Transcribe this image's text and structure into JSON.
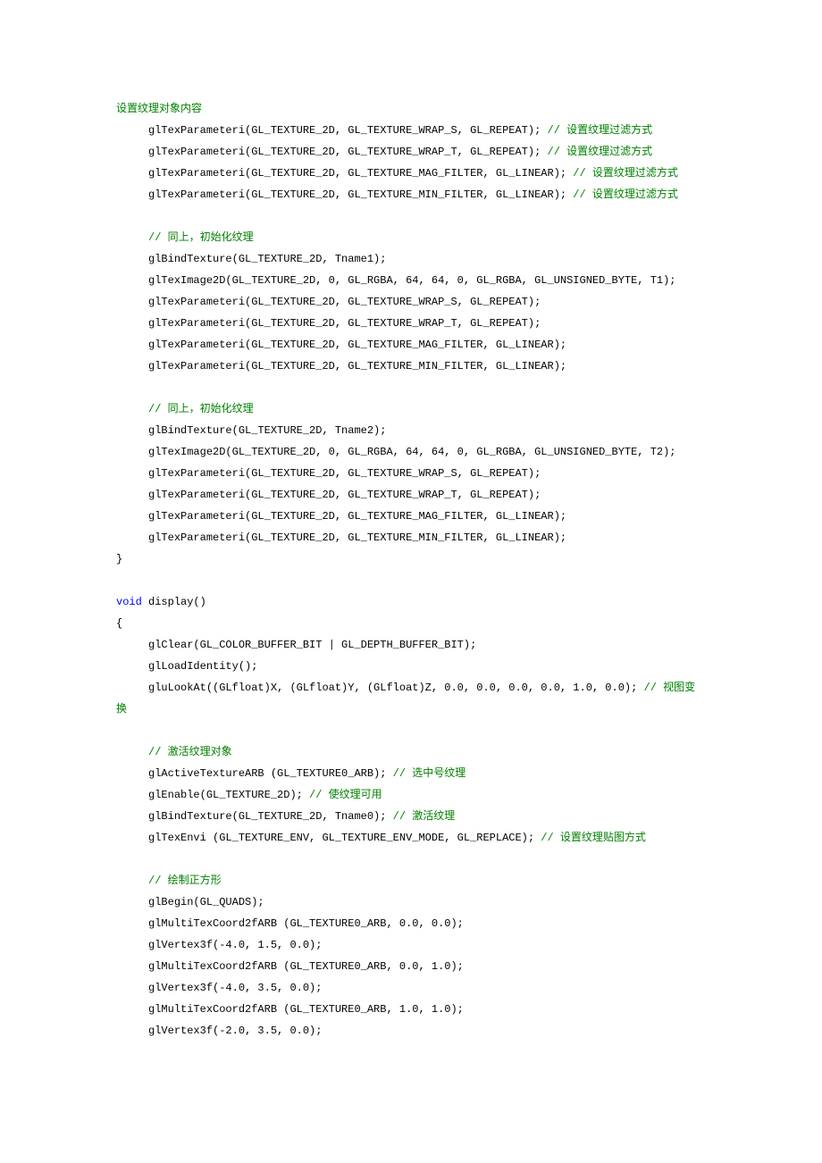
{
  "lines": [
    {
      "indent": 0,
      "segs": [
        {
          "t": "设置纹理对象内容",
          "c": "c-green"
        }
      ]
    },
    {
      "indent": 1,
      "segs": [
        {
          "t": "glTexParameteri(GL_TEXTURE_2D, GL_TEXTURE_WRAP_S, GL_REPEAT);"
        },
        {
          "t": " // 设置纹理过滤方式",
          "c": "c-green"
        }
      ]
    },
    {
      "indent": 1,
      "segs": [
        {
          "t": "glTexParameteri(GL_TEXTURE_2D, GL_TEXTURE_WRAP_T, GL_REPEAT);"
        },
        {
          "t": " // 设置纹理过滤方式",
          "c": "c-green"
        }
      ]
    },
    {
      "indent": 1,
      "segs": [
        {
          "t": "glTexParameteri(GL_TEXTURE_2D, GL_TEXTURE_MAG_FILTER, GL_LINEAR);"
        },
        {
          "t": " // 设置纹理过滤方式",
          "c": "c-green"
        }
      ]
    },
    {
      "indent": 1,
      "segs": [
        {
          "t": "glTexParameteri(GL_TEXTURE_2D, GL_TEXTURE_MIN_FILTER, GL_LINEAR);"
        },
        {
          "t": " // 设置纹理过滤方式",
          "c": "c-green"
        }
      ]
    },
    {
      "indent": 0,
      "segs": [
        {
          "t": " "
        }
      ]
    },
    {
      "indent": 1,
      "segs": [
        {
          "t": "// 同上，初始化纹理",
          "c": "c-green"
        }
      ]
    },
    {
      "indent": 1,
      "segs": [
        {
          "t": "glBindTexture(GL_TEXTURE_2D, Tname1);"
        }
      ]
    },
    {
      "indent": 1,
      "segs": [
        {
          "t": "glTexImage2D(GL_TEXTURE_2D, 0, GL_RGBA, 64, 64, 0, GL_RGBA, GL_UNSIGNED_BYTE, T1);"
        }
      ]
    },
    {
      "indent": 1,
      "segs": [
        {
          "t": "glTexParameteri(GL_TEXTURE_2D, GL_TEXTURE_WRAP_S, GL_REPEAT);"
        }
      ]
    },
    {
      "indent": 1,
      "segs": [
        {
          "t": "glTexParameteri(GL_TEXTURE_2D, GL_TEXTURE_WRAP_T, GL_REPEAT);"
        }
      ]
    },
    {
      "indent": 1,
      "segs": [
        {
          "t": "glTexParameteri(GL_TEXTURE_2D, GL_TEXTURE_MAG_FILTER, GL_LINEAR);"
        }
      ]
    },
    {
      "indent": 1,
      "segs": [
        {
          "t": "glTexParameteri(GL_TEXTURE_2D, GL_TEXTURE_MIN_FILTER, GL_LINEAR);"
        }
      ]
    },
    {
      "indent": 0,
      "segs": [
        {
          "t": " "
        }
      ]
    },
    {
      "indent": 1,
      "segs": [
        {
          "t": "// 同上，初始化纹理",
          "c": "c-green"
        }
      ]
    },
    {
      "indent": 1,
      "segs": [
        {
          "t": "glBindTexture(GL_TEXTURE_2D, Tname2);"
        }
      ]
    },
    {
      "indent": 1,
      "segs": [
        {
          "t": "glTexImage2D(GL_TEXTURE_2D, 0, GL_RGBA, 64, 64, 0, GL_RGBA, GL_UNSIGNED_BYTE, T2);"
        }
      ]
    },
    {
      "indent": 1,
      "segs": [
        {
          "t": "glTexParameteri(GL_TEXTURE_2D, GL_TEXTURE_WRAP_S, GL_REPEAT);"
        }
      ]
    },
    {
      "indent": 1,
      "segs": [
        {
          "t": "glTexParameteri(GL_TEXTURE_2D, GL_TEXTURE_WRAP_T, GL_REPEAT);"
        }
      ]
    },
    {
      "indent": 1,
      "segs": [
        {
          "t": "glTexParameteri(GL_TEXTURE_2D, GL_TEXTURE_MAG_FILTER, GL_LINEAR);"
        }
      ]
    },
    {
      "indent": 1,
      "segs": [
        {
          "t": "glTexParameteri(GL_TEXTURE_2D, GL_TEXTURE_MIN_FILTER, GL_LINEAR);"
        }
      ]
    },
    {
      "indent": 0,
      "segs": [
        {
          "t": "}"
        }
      ]
    },
    {
      "indent": 0,
      "segs": [
        {
          "t": " "
        }
      ]
    },
    {
      "indent": 0,
      "segs": [
        {
          "t": "void",
          "c": "c-blue"
        },
        {
          "t": " display()"
        }
      ]
    },
    {
      "indent": 0,
      "segs": [
        {
          "t": "{"
        }
      ]
    },
    {
      "indent": 1,
      "segs": [
        {
          "t": "glClear(GL_COLOR_BUFFER_BIT | GL_DEPTH_BUFFER_BIT);"
        }
      ]
    },
    {
      "indent": 1,
      "segs": [
        {
          "t": "glLoadIdentity();"
        }
      ]
    },
    {
      "indent": 1,
      "segs": [
        {
          "t": "gluLookAt((GLfloat)X, (GLfloat)Y, (GLfloat)Z, 0.0, 0.0, 0.0, 0.0, 1.0, 0.0);"
        },
        {
          "t": " // 视图变",
          "c": "c-green"
        }
      ]
    },
    {
      "indent": 0,
      "segs": [
        {
          "t": "换",
          "c": "c-green"
        }
      ]
    },
    {
      "indent": 0,
      "segs": [
        {
          "t": " "
        }
      ]
    },
    {
      "indent": 1,
      "segs": [
        {
          "t": "// 激活纹理对象",
          "c": "c-green"
        }
      ]
    },
    {
      "indent": 1,
      "segs": [
        {
          "t": "glActiveTextureARB (GL_TEXTURE0_ARB);"
        },
        {
          "t": " // 选中号纹理",
          "c": "c-green"
        }
      ]
    },
    {
      "indent": 1,
      "segs": [
        {
          "t": "glEnable(GL_TEXTURE_2D);"
        },
        {
          "t": " // 使纹理可用",
          "c": "c-green"
        }
      ]
    },
    {
      "indent": 1,
      "segs": [
        {
          "t": "glBindTexture(GL_TEXTURE_2D, Tname0);"
        },
        {
          "t": " // 激活纹理",
          "c": "c-green"
        }
      ]
    },
    {
      "indent": 1,
      "segs": [
        {
          "t": "glTexEnvi (GL_TEXTURE_ENV, GL_TEXTURE_ENV_MODE, GL_REPLACE);"
        },
        {
          "t": " // 设置纹理贴图方式",
          "c": "c-green"
        }
      ]
    },
    {
      "indent": 0,
      "segs": [
        {
          "t": " "
        }
      ]
    },
    {
      "indent": 1,
      "segs": [
        {
          "t": "// 绘制正方形",
          "c": "c-green"
        }
      ]
    },
    {
      "indent": 1,
      "segs": [
        {
          "t": "glBegin(GL_QUADS);"
        }
      ]
    },
    {
      "indent": 1,
      "segs": [
        {
          "t": "glMultiTexCoord2fARB (GL_TEXTURE0_ARB, 0.0, 0.0);"
        }
      ]
    },
    {
      "indent": 1,
      "segs": [
        {
          "t": "glVertex3f(-4.0, 1.5, 0.0);"
        }
      ]
    },
    {
      "indent": 1,
      "segs": [
        {
          "t": "glMultiTexCoord2fARB (GL_TEXTURE0_ARB, 0.0, 1.0);"
        }
      ]
    },
    {
      "indent": 1,
      "segs": [
        {
          "t": "glVertex3f(-4.0, 3.5, 0.0);"
        }
      ]
    },
    {
      "indent": 1,
      "segs": [
        {
          "t": "glMultiTexCoord2fARB (GL_TEXTURE0_ARB, 1.0, 1.0);"
        }
      ]
    },
    {
      "indent": 1,
      "segs": [
        {
          "t": "glVertex3f(-2.0, 3.5, 0.0);"
        }
      ]
    }
  ],
  "indent_spaces": "     "
}
